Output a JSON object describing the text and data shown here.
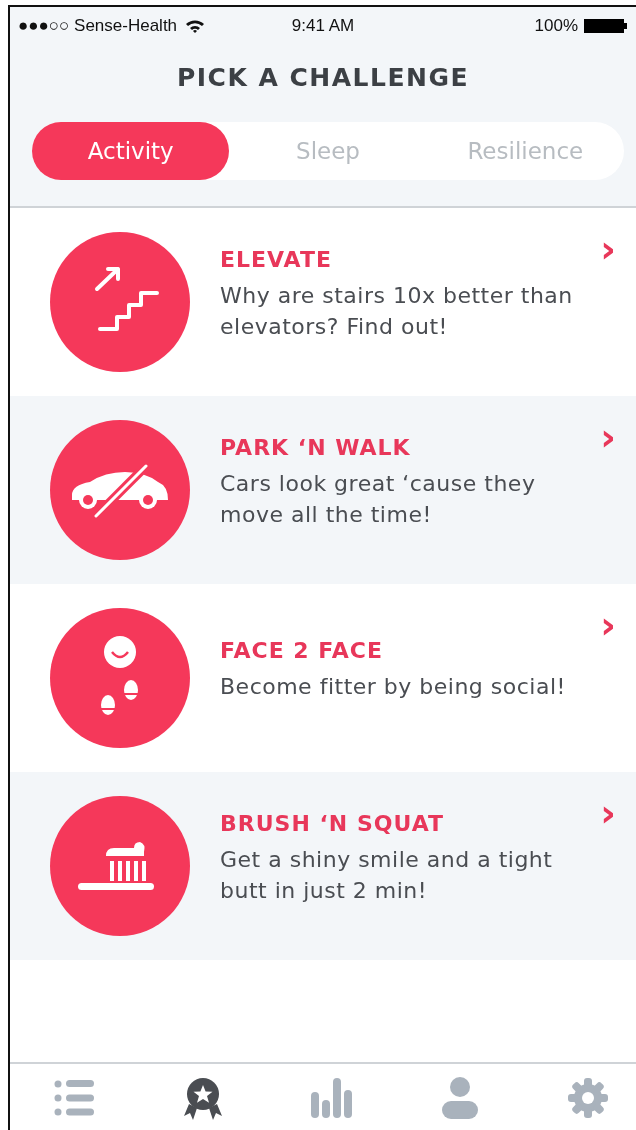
{
  "status_bar": {
    "carrier": "●●●○○ Sense-Health",
    "time": "9:41 AM",
    "battery": "100%"
  },
  "title": "PICK A CHALLENGE",
  "tabs": [
    {
      "label": "Activity",
      "selected": true
    },
    {
      "label": "Sleep",
      "selected": false
    },
    {
      "label": "Resilience",
      "selected": false
    }
  ],
  "challenges": [
    {
      "title": "ELEVATE",
      "description": "Why are stairs 10x better than elevators? Find out!",
      "chevron": "›"
    },
    {
      "title": "PARK ‘N WALK",
      "description": "Cars look great ‘cause they move all the time!",
      "chevron": "›"
    },
    {
      "title": "FACE 2 FACE",
      "description": "Become fitter by being social!",
      "chevron": "›"
    },
    {
      "title": "BRUSH ‘N SQUAT",
      "description": "Get a shiny smile and a tight butt in just 2 min!",
      "chevron": "›"
    }
  ],
  "tab_bar": [
    {
      "selected": false
    },
    {
      "selected": true
    },
    {
      "selected": false
    },
    {
      "selected": false
    },
    {
      "selected": false
    }
  ]
}
